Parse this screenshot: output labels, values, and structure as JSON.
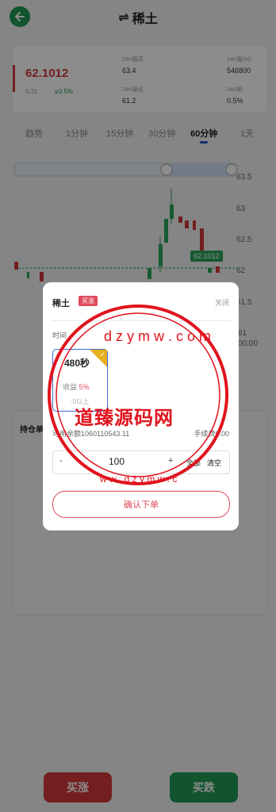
{
  "header": {
    "title": "稀土",
    "swap_icon": "⇌"
  },
  "stats": {
    "price": "62.1012",
    "change_abs": "0.31",
    "change_pct": "∨0.5%",
    "high_label": "24H最高",
    "high_value": "63.4",
    "vol_label": "24H量(M)",
    "vol_value": "546800",
    "low_label": "24H最低",
    "low_value": "61.2",
    "amp_label": "24H额",
    "amp_value": "0.5%"
  },
  "tabs": [
    "趋势",
    "1分钟",
    "15分钟",
    "30分钟",
    "60分钟",
    "1天"
  ],
  "chart": {
    "y_labels": [
      "63.5",
      "63",
      "62.5",
      "62",
      "61.5",
      "61",
      "00:00"
    ],
    "current_price_tag": "62.1012"
  },
  "holdings": {
    "label": "持仓单"
  },
  "bottom": {
    "buy_up": "买涨",
    "buy_down": "买跌"
  },
  "modal": {
    "title": "稀土",
    "badge": "买涨",
    "close": "关闭",
    "time_label": "时间",
    "option": {
      "time": "480秒",
      "yield_label": "收益",
      "yield_value": "5%",
      "min": "-0以上"
    },
    "balance": "可用余额1060110543.11",
    "fee": "手续费0.00",
    "quantity": "100",
    "minus": "-",
    "plus": "+",
    "all": "全部",
    "clear": "清空",
    "confirm": "确认下单"
  },
  "watermark": {
    "text": "道臻源码网",
    "ring": "dzymw.com"
  }
}
